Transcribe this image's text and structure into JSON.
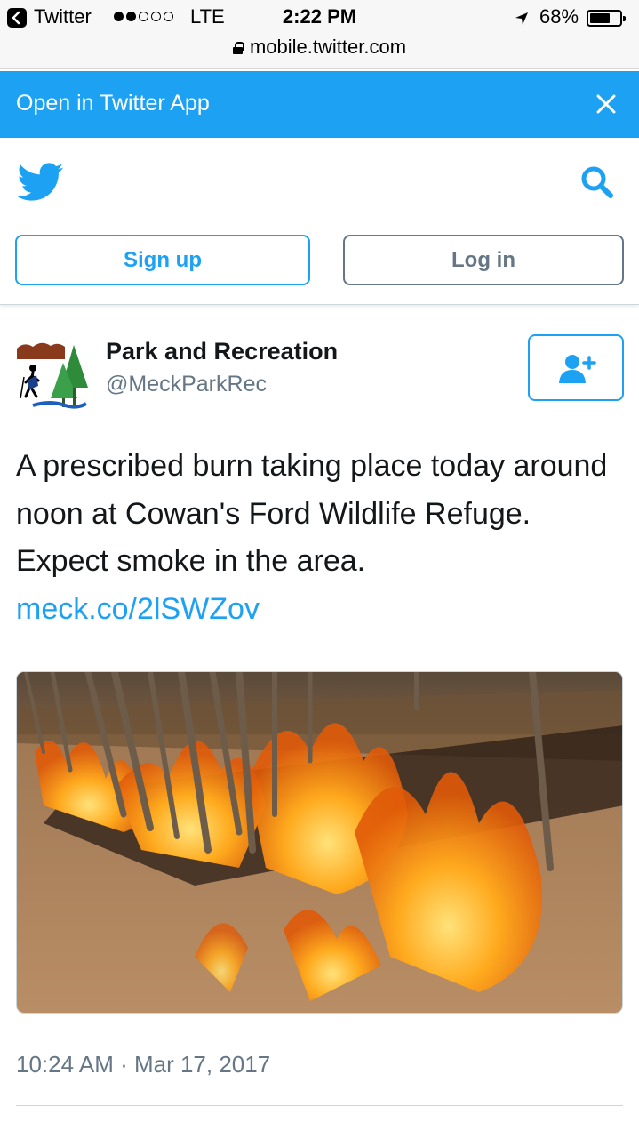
{
  "status_bar": {
    "back_app": "Twitter",
    "signal": "●●○○○",
    "network": "LTE",
    "time": "2:22 PM",
    "battery": "68%",
    "battery_level": 0.68,
    "url": "mobile.twitter.com",
    "icons": [
      "back-arrow-icon",
      "location-arrow-icon",
      "battery-icon",
      "lock-icon"
    ]
  },
  "banner": {
    "text": "Open in Twitter App",
    "background": "#1da1f2",
    "close_icon": "close-icon"
  },
  "header": {
    "logo_icon": "twitter-bird-icon",
    "search_icon": "search-icon",
    "signup_label": "Sign up",
    "login_label": "Log in",
    "accent": "#1da1f2"
  },
  "tweet": {
    "author_name": "Park and Recreation",
    "author_handle": "@MeckParkRec",
    "avatar_icon": "park-logo-icon",
    "follow_icon": "follow-user-icon",
    "text": "A prescribed burn taking place today around noon at Cowan's Ford Wildlife Refuge. Expect smoke in the area.",
    "link": "meck.co/2lSWZov",
    "photo": "photo of a controlled burn among bare trees",
    "timestamp": "10:24 AM · Mar 17, 2017"
  }
}
